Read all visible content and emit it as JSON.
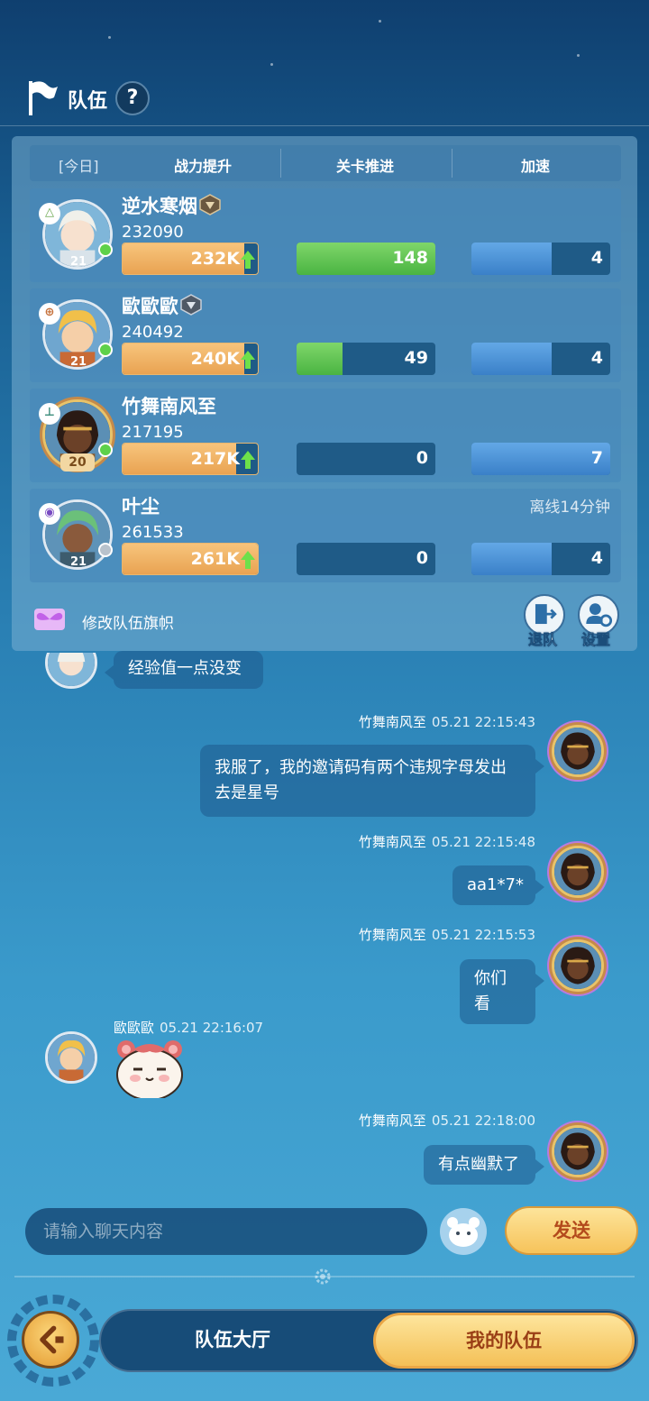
{
  "header": {
    "title": "队伍",
    "help_label": "?"
  },
  "stats_header": {
    "today": "[今日]",
    "col_power": "战力提升",
    "col_stage": "关卡推进",
    "col_speed": "加速"
  },
  "members": [
    {
      "name": "逆水寒烟",
      "power": "232090",
      "level": "21",
      "power_bar": "232K",
      "stage": "148",
      "stage_fill": 1.0,
      "speed": "4",
      "speed_fill": 0.58,
      "status": "online",
      "offline_text": ""
    },
    {
      "name": "歐歐歐",
      "power": "240492",
      "level": "21",
      "power_bar": "240K",
      "stage": "49",
      "stage_fill": 0.33,
      "speed": "4",
      "speed_fill": 0.58,
      "status": "online",
      "offline_text": ""
    },
    {
      "name": "竹舞南风至",
      "power": "217195",
      "level": "20",
      "power_bar": "217K",
      "stage": "0",
      "stage_fill": 0,
      "speed": "7",
      "speed_fill": 1.0,
      "status": "online",
      "offline_text": ""
    },
    {
      "name": "叶尘",
      "power": "261533",
      "level": "21",
      "power_bar": "261K",
      "stage": "0",
      "stage_fill": 0,
      "speed": "4",
      "speed_fill": 0.58,
      "status": "offline",
      "offline_text": "离线14分钟"
    }
  ],
  "panel_actions": {
    "edit_flag": "修改队伍旗帜",
    "leave": "退队",
    "settings": "设置"
  },
  "chat": [
    {
      "sender": "",
      "time": "",
      "text": "经验值一点没变",
      "side": "left"
    },
    {
      "sender": "竹舞南风至",
      "time": "05.21 22:15:43",
      "text": "我服了，我的邀请码有两个违规字母发出去是星号",
      "side": "right"
    },
    {
      "sender": "竹舞南风至",
      "time": "05.21 22:15:48",
      "text": "aa1*7*",
      "side": "right"
    },
    {
      "sender": "竹舞南风至",
      "time": "05.21 22:15:53",
      "text": "你们看",
      "side": "right"
    },
    {
      "sender": "歐歐歐",
      "time": "05.21 22:16:07",
      "text": "",
      "side": "left"
    },
    {
      "sender": "竹舞南风至",
      "time": "05.21 22:18:00",
      "text": "有点幽默了",
      "side": "right"
    }
  ],
  "input": {
    "placeholder": "请输入聊天内容",
    "send_label": "发送"
  },
  "nav": {
    "lobby": "队伍大厅",
    "my_team": "我的队伍"
  },
  "colors": {
    "accent_gold": "#f6c35a",
    "stage_green": "#4ab442",
    "speed_blue": "#3a80c8",
    "power_orange": "#e9a352"
  }
}
